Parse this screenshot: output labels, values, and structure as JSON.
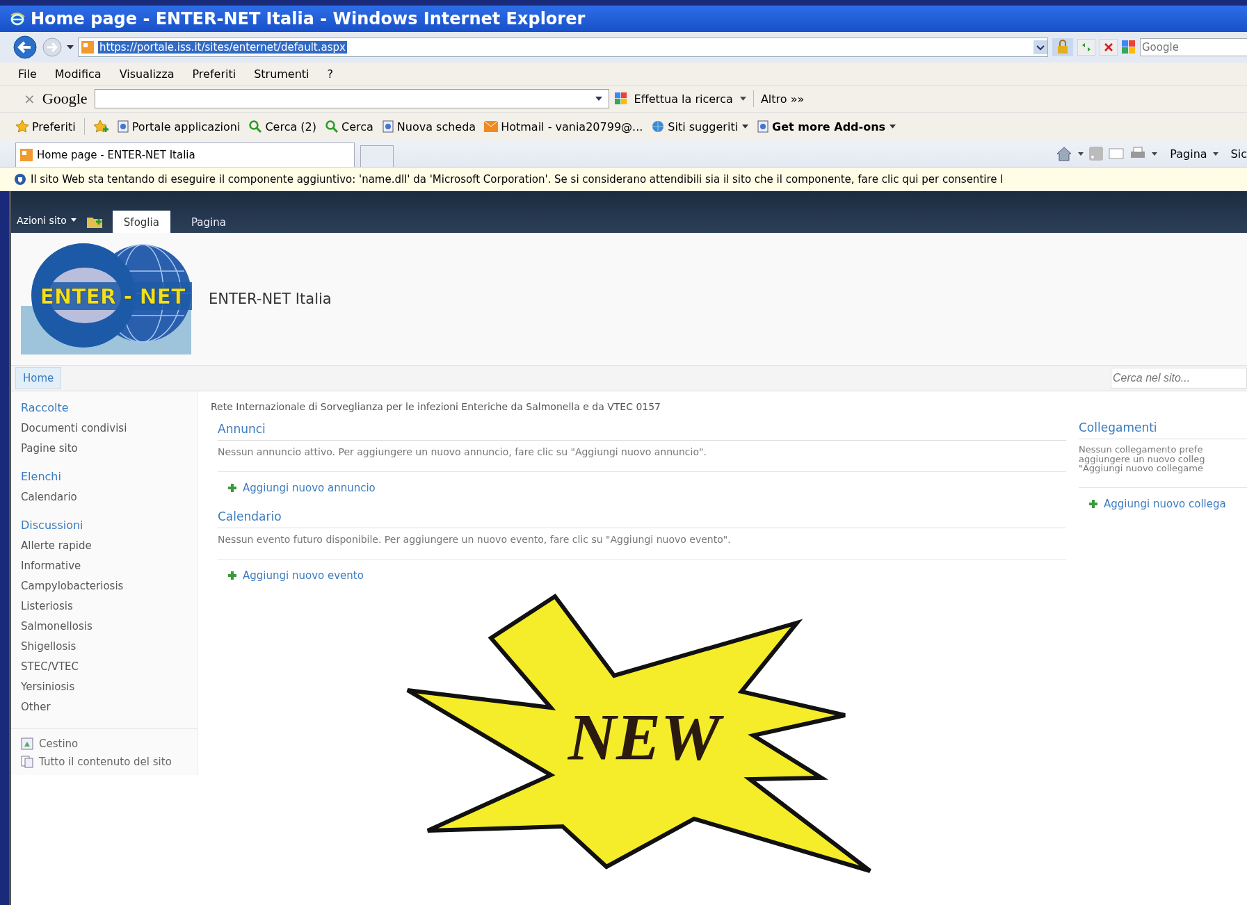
{
  "window": {
    "title": "Home page - ENTER-NET Italia - Windows Internet Explorer"
  },
  "address_bar": {
    "url": "https://portale.iss.it/sites/enternet/default.aspx",
    "search_placeholder": "Google"
  },
  "menu": [
    "File",
    "Modifica",
    "Visualizza",
    "Preferiti",
    "Strumenti",
    "?"
  ],
  "google_toolbar": {
    "close": "×",
    "logo": "Google",
    "search_button": "Effettua la ricerca",
    "more": "Altro »»"
  },
  "favorites_bar": [
    {
      "label": "Preferiti",
      "kind": "star",
      "dropdown": false,
      "bold": false
    },
    {
      "label": "Portale applicazioni",
      "kind": "page",
      "dropdown": false,
      "bold": false
    },
    {
      "label": "Cerca (2)",
      "kind": "search",
      "dropdown": false,
      "bold": false
    },
    {
      "label": "Cerca",
      "kind": "search",
      "dropdown": false,
      "bold": false
    },
    {
      "label": "Nuova scheda",
      "kind": "page",
      "dropdown": false,
      "bold": false
    },
    {
      "label": "Hotmail - vania20799@...",
      "kind": "mail",
      "dropdown": false,
      "bold": false
    },
    {
      "label": "Siti suggeriti",
      "kind": "globe",
      "dropdown": true,
      "bold": false
    },
    {
      "label": "Get more Add-ons",
      "kind": "page",
      "dropdown": true,
      "bold": true
    }
  ],
  "tabs": [
    {
      "label": "Home page - ENTER-NET Italia",
      "selected": true
    }
  ],
  "command_bar": [
    "Pagina",
    "Sic"
  ],
  "info_bar": "Il sito Web sta tentando di eseguire il componente aggiuntivo: 'name.dll' da 'Microsoft Corporation'. Se si considerano attendibili sia il sito che il componente, fare clic qui per consentire l",
  "ribbon": {
    "site_actions": "Azioni sito",
    "tabs": [
      {
        "label": "Sfoglia",
        "selected": true
      },
      {
        "label": "Pagina",
        "selected": false
      }
    ]
  },
  "site": {
    "logo_text": "ENTER - NET",
    "title": "ENTER-NET Italia"
  },
  "top_nav": {
    "items": [
      {
        "label": "Home",
        "selected": true
      }
    ],
    "search_placeholder": "Cerca nel sito..."
  },
  "quick_launch": {
    "sections": [
      {
        "heading": "Raccolte",
        "items": [
          "Documenti condivisi",
          "Pagine sito"
        ]
      },
      {
        "heading": "Elenchi",
        "items": [
          "Calendario"
        ]
      },
      {
        "heading": "Discussioni",
        "items": [
          "Allerte rapide",
          "Informative",
          "Campylobacteriosis",
          "Listeriosis",
          "Salmonellosis",
          "Shigellosis",
          "STEC/VTEC",
          "Yersiniosis",
          "Other"
        ]
      }
    ],
    "footer": [
      {
        "label": "Cestino",
        "kind": "recycle"
      },
      {
        "label": "Tutto il contenuto del sito",
        "kind": "content"
      }
    ]
  },
  "description": "Rete Internazionale di Sorveglianza per le infezioni Enteriche da Salmonella e da VTEC 0157",
  "web_parts": [
    {
      "title": "Annunci",
      "message": "Nessun annuncio attivo. Per aggiungere un nuovo annuncio, fare clic su \"Aggiungi nuovo annuncio\".",
      "add_link": "Aggiungi nuovo annuncio"
    },
    {
      "title": "Calendario",
      "message": "Nessun evento futuro disponibile. Per aggiungere un nuovo evento, fare clic su \"Aggiungi nuovo evento\".",
      "add_link": "Aggiungi nuovo evento"
    }
  ],
  "right_web_part": {
    "title": "Collegamenti",
    "message_lines": [
      "Nessun collegamento prefe",
      "aggiungere un nuovo colleg",
      "\"Aggiungi nuovo collegame"
    ],
    "add_link": "Aggiungi nuovo collega"
  },
  "badge": {
    "text": "NEW"
  }
}
